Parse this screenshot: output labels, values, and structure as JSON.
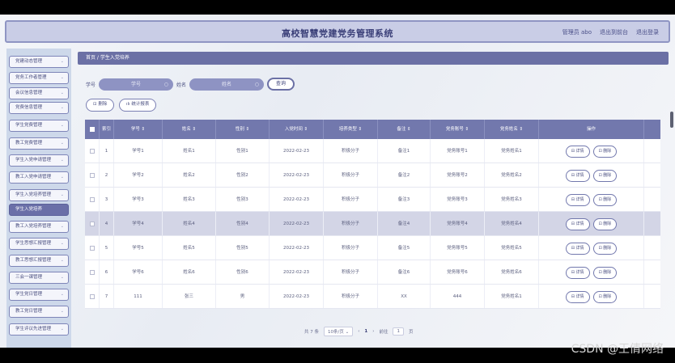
{
  "app": {
    "title": "高校智慧党建党务管理系统",
    "admin_label": "管理员 abo",
    "exit_console": "退出到前台",
    "exit_login": "退出登录"
  },
  "sidebar": {
    "items": [
      {
        "label": "党建动态管理"
      },
      {
        "label": "党务工作者管理"
      },
      {
        "label": "会议信息管理"
      },
      {
        "label": "党费信息管理"
      },
      {
        "label": "学生党费管理"
      },
      {
        "label": "教工党费管理"
      },
      {
        "label": "学生入党申请管理"
      },
      {
        "label": "教工入党申请管理"
      },
      {
        "label": "学生入党培养管理"
      },
      {
        "label": "学生入党培养",
        "active": true
      },
      {
        "label": "教工入党培养管理"
      },
      {
        "label": "学生思想汇报管理"
      },
      {
        "label": "教工思想汇报管理"
      },
      {
        "label": "三会一课管理"
      },
      {
        "label": "学生党日管理"
      },
      {
        "label": "教工党日管理"
      },
      {
        "label": "学生评议先进管理"
      }
    ]
  },
  "breadcrumb": "首页 / 学生入党培养",
  "search": {
    "label1": "学号",
    "placeholder1": "学号",
    "label2": "姓名",
    "placeholder2": "姓名",
    "query": "查询"
  },
  "toolbar": {
    "delete": "删除",
    "stats": "统计报表"
  },
  "table": {
    "headers": [
      "索引",
      "学号 ⇕",
      "姓名 ⇕",
      "性别 ⇕",
      "入党时间 ⇕",
      "培养类型 ⇕",
      "备注 ⇕",
      "党务账号 ⇕",
      "党务姓名 ⇕",
      "操作"
    ],
    "rows": [
      [
        "1",
        "学号1",
        "姓名1",
        "性别1",
        "2022-02-23",
        "积极分子",
        "备注1",
        "党务账号1",
        "党务姓名1"
      ],
      [
        "2",
        "学号2",
        "姓名2",
        "性别2",
        "2022-02-23",
        "积极分子",
        "备注2",
        "党务账号2",
        "党务姓名2"
      ],
      [
        "3",
        "学号3",
        "姓名3",
        "性别3",
        "2022-02-23",
        "积极分子",
        "备注3",
        "党务账号3",
        "党务姓名3"
      ],
      [
        "4",
        "学号4",
        "姓名4",
        "性别4",
        "2022-02-23",
        "积极分子",
        "备注4",
        "党务账号4",
        "党务姓名4"
      ],
      [
        "5",
        "学号5",
        "姓名5",
        "性别5",
        "2022-02-23",
        "积极分子",
        "备注5",
        "党务账号5",
        "党务姓名5"
      ],
      [
        "6",
        "学号6",
        "姓名6",
        "性别6",
        "2022-02-23",
        "积极分子",
        "备注6",
        "党务账号6",
        "党务姓名6"
      ],
      [
        "7",
        "111",
        "张三",
        "男",
        "2022-02-23",
        "积极分子",
        "XX",
        "444",
        "党务姓名1"
      ]
    ],
    "highlight_row": 4,
    "detail": "详情",
    "delete": "删除"
  },
  "pager": {
    "total": "共 7 条",
    "page_size": "10条/页",
    "prev": "‹",
    "current": "1",
    "next": "›",
    "goto": "前往",
    "goto_value": "1",
    "page_suffix": "页"
  },
  "watermark": "CSDN @王倩网络",
  "colors": {
    "accent": "#6b70a5",
    "header": "#7278ad",
    "highlight": "#d3d5e6"
  }
}
